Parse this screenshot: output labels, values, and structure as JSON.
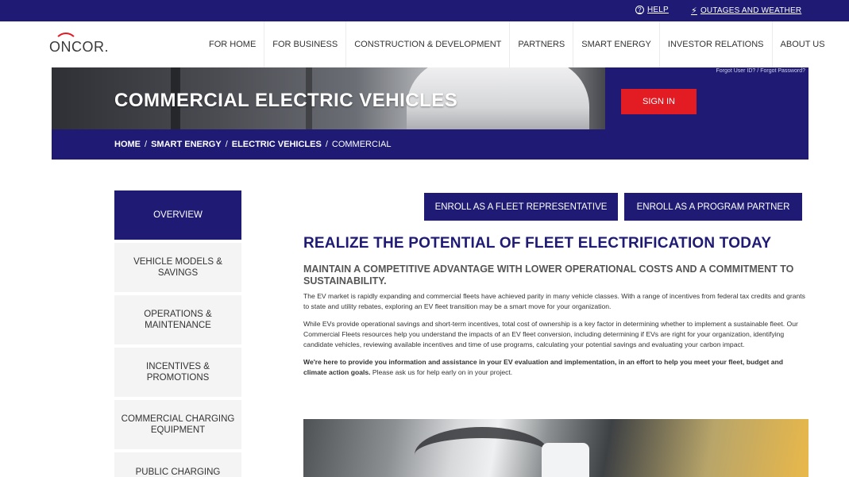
{
  "topbar": {
    "help_label": "HELP",
    "outages_label": "OUTAGES AND WEATHER",
    "help_icon": "question-circle-icon",
    "outages_icon": "lightning-icon"
  },
  "header": {
    "logo_text": "ONCOR.",
    "nav": [
      {
        "label": "FOR HOME"
      },
      {
        "label": "FOR BUSINESS"
      },
      {
        "label": "CONSTRUCTION & DEVELOPMENT"
      },
      {
        "label": "PARTNERS"
      },
      {
        "label": "SMART ENERGY"
      },
      {
        "label": "INVESTOR RELATIONS"
      },
      {
        "label": "ABOUT US"
      }
    ]
  },
  "hero": {
    "title": "COMMERCIAL ELECTRIC VEHICLES",
    "breadcrumb": [
      "HOME",
      "SMART ENERGY",
      "ELECTRIC VEHICLES",
      "COMMERCIAL"
    ],
    "forgot_user": "Forgot User ID?",
    "forgot_sep": "/",
    "forgot_password": "Forgot Password?",
    "signin_label": "SIGN IN"
  },
  "sidebar": {
    "items": [
      {
        "label": "OVERVIEW"
      },
      {
        "label": "VEHICLE MODELS & SAVINGS"
      },
      {
        "label": "OPERATIONS & MAINTENANCE"
      },
      {
        "label": "INCENTIVES & PROMOTIONS"
      },
      {
        "label": "COMMERCIAL CHARGING EQUIPMENT"
      },
      {
        "label": "PUBLIC CHARGING"
      }
    ]
  },
  "buttons": {
    "enroll_fleet": "ENROLL AS A FLEET REPRESENTATIVE",
    "enroll_partner": "ENROLL AS A PROGRAM PARTNER"
  },
  "main": {
    "heading": "REALIZE THE POTENTIAL OF FLEET ELECTRIFICATION TODAY",
    "subheading": "MAINTAIN A COMPETITIVE ADVANTAGE WITH LOWER OPERATIONAL COSTS AND A COMMITMENT TO SUSTAINABILITY.",
    "para1": "The EV market is rapidly expanding and commercial fleets have achieved parity in many vehicle classes. With a range of incentives from federal tax credits and grants to state and utility rebates, exploring an EV fleet transition may be a smart move for your organization.",
    "para2": "While EVs provide operational savings and short-term incentives, total cost of ownership is a key factor in determining whether to implement a sustainable fleet. Our Commercial Fleets resources help you understand the impacts of an EV fleet conversion, including determining if EVs are right for your organization, identifying candidate vehicles, reviewing available incentives and time of use programs, calculating your potential savings and evaluating your carbon impact.",
    "para3_bold": "We're here to provide you information and assistance in your EV evaluation and implementation, in an effort to help you meet your fleet, budget and climate action goals.",
    "para3_rest": " Please ask us for help early on in your project."
  },
  "colors": {
    "brand_navy": "#1f1b74",
    "brand_red": "#e31b23"
  }
}
